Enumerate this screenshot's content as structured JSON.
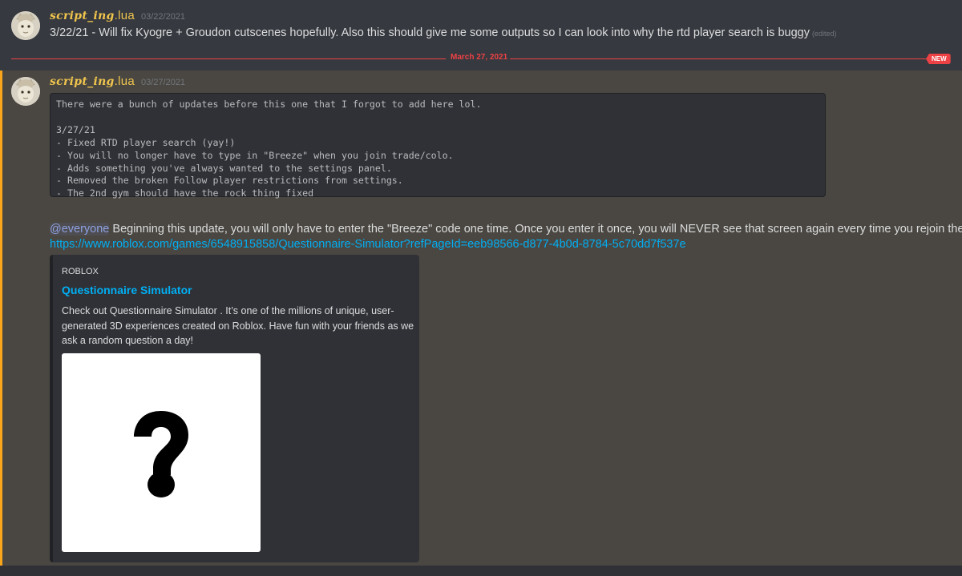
{
  "messages": [
    {
      "username": "script_ing",
      "username_ext": ".lua",
      "timestamp": "03/22/2021",
      "text": "3/22/21 - Will fix Kyogre + Groudon cutscenes hopefully. Also this should give me some outputs so I can look into why the rtd player search is buggy",
      "edited_label": "(edited)"
    },
    {
      "username": "script_ing",
      "username_ext": ".lua",
      "timestamp": "03/27/2021",
      "code_block": "There were a bunch of updates before this one that I forgot to add here lol.\n\n3/27/21\n- Fixed RTD player search (yay!)\n- You will no longer have to type in \"Breeze\" when you join trade/colo.\n- Adds something you've always wanted to the settings panel.\n- Removed the broken Follow player restrictions from settings.\n- The 2nd gym should have the rock thing fixed",
      "mention": "@everyone",
      "text": " Beginning this update, you will only have to enter the \"Breeze\" code one time. Once you enter it once, you will NEVER see that screen again every time you rejoin the game.",
      "link": "https://www.roblox.com/games/6548915858/Questionnaire-Simulator?refPageId=eeb98566-d877-4b0d-8784-5c70dd7f537e",
      "embed": {
        "provider": "ROBLOX",
        "title": "Questionnaire Simulator",
        "description": "Check out Questionnaire Simulator . It’s one of the millions of unique, user-generated 3D experiences created on Roblox. Have fun with your friends as we ask a random question a day!",
        "thumbnail_glyph": "?"
      }
    }
  ],
  "divider": {
    "date": "March 27, 2021",
    "badge": "NEW"
  },
  "colors": {
    "background": "#36393f",
    "mention_highlight": "#4a4742",
    "mention_bar": "#faa61a",
    "username": "#f0c54d",
    "link": "#00aff4",
    "new_divider": "#ed4245"
  }
}
